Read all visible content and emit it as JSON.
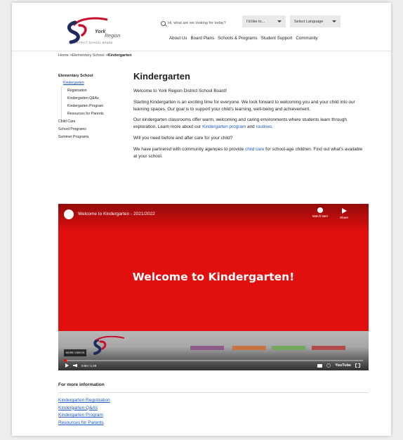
{
  "header": {
    "logo_name": "York",
    "logo_region": "Region",
    "logo_sub": "DISTRICT SCHOOL BOARD",
    "search_placeholder": "Hi, what are we looking for today?",
    "dropdown_id_like_to": "I'd like to...",
    "dropdown_language": "Select Language",
    "nav": [
      "About Us",
      "Board Plans",
      "Schools & Programs",
      "Student Support",
      "Community"
    ]
  },
  "breadcrumb": {
    "home": "Home",
    "sep": " >",
    "level1": "Elementary School",
    "current": "Kindergarten"
  },
  "sidebar": {
    "heading": "Elementary School",
    "current": "Kindergarten",
    "sub_items": [
      "Registration",
      "Kindergarten Q&As",
      "Kindergarten Program",
      "Resources for Parents"
    ],
    "top_items": [
      "Child Care",
      "School Programs",
      "Summer Programs"
    ]
  },
  "main": {
    "title": "Kindergarten",
    "p1": "Welcome to York Region District School Board!",
    "p2": "Starting Kindergarten is an exciting time for everyone. We look forward to welcoming you and your child into our learning spaces. Our goal is to support your child's learning, well-being and achievement.",
    "p3_a": "Our kindergarten classrooms offer warm, welcoming and caring environments where students learn through exploration. Learn more about our ",
    "p3_link1": "Kindergarten program",
    "p3_b": " and ",
    "p3_link2": "routines",
    "p3_c": ".",
    "p4": "Will you need before and after care for your child?",
    "p5_a": "We have partnered with community agencies to provide ",
    "p5_link": "child care",
    "p5_b": " for school-age children. Find out what's available at your school."
  },
  "video": {
    "title": "Welcome to Kindergarten - 2021/2022",
    "watch_later": "Watch later",
    "share": "Share",
    "big_text": "Welcome to Kindergarten!",
    "more_videos": "MORE VIDEOS",
    "time": "0:00 / 1:29",
    "youtube": "YouTube",
    "progress": 0,
    "colors": {
      "bg": "#e20f0f",
      "bar1": "#8e5a8a",
      "bar2": "#c87442",
      "bar3": "#72a85e",
      "bar4": "#b14a4a"
    }
  },
  "more_info": {
    "heading": "For more information",
    "links": [
      "Kindergarten Registration",
      "Kindergarten Q&As",
      "Kindergarten Program",
      "Resources for Parents"
    ]
  },
  "colors": {
    "link": "#1d56c9",
    "brand_red": "#c8102e",
    "brand_navy": "#1f2a5c"
  }
}
